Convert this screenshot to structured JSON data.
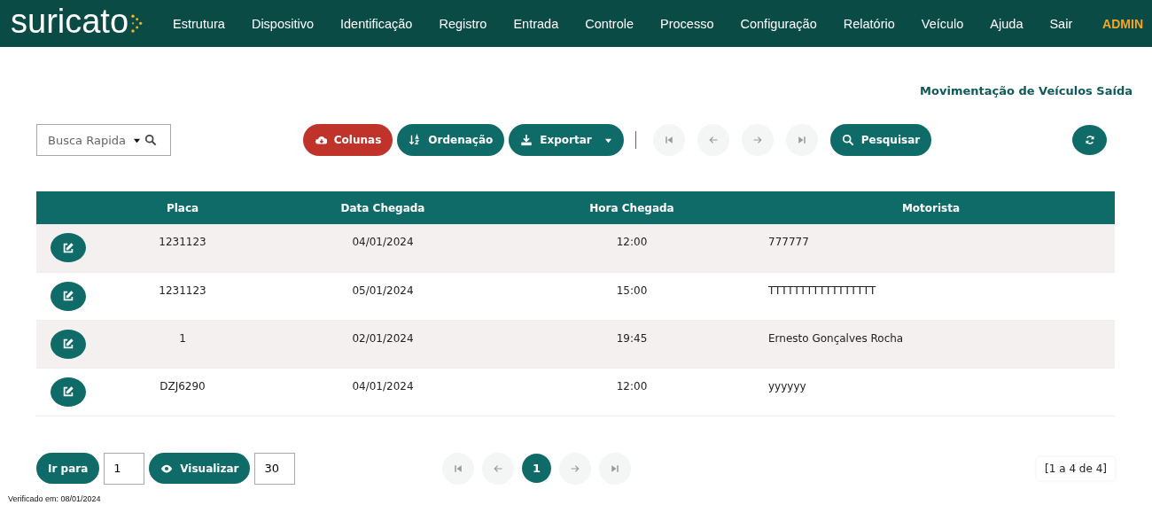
{
  "navbar": {
    "logo": "suricato",
    "items": [
      "Estrutura",
      "Dispositivo",
      "Identificação",
      "Registro",
      "Entrada",
      "Controle",
      "Processo",
      "Configuração",
      "Relatório",
      "Veículo",
      "Ajuda",
      "Sair"
    ],
    "user": "ADMIN"
  },
  "page_title": "Movimentação de Veículos Saída",
  "search": {
    "placeholder": "Busca Rapida"
  },
  "toolbar": [
    {
      "kind": "columns",
      "label": "Colunas",
      "dropdown": false
    },
    {
      "kind": "sort",
      "label": "Ordenação",
      "dropdown": false
    },
    {
      "kind": "export",
      "label": "Exportar",
      "dropdown": true
    },
    {
      "kind": "separator"
    },
    {
      "kind": "first",
      "disabled": true
    },
    {
      "kind": "prev",
      "disabled": true
    },
    {
      "kind": "next",
      "disabled": true
    },
    {
      "kind": "last",
      "disabled": true
    },
    {
      "kind": "search",
      "label": "Pesquisar",
      "dropdown": false
    }
  ],
  "table": {
    "columns": [
      "Placa",
      "Data Chegada",
      "Hora Chegada",
      "Motorista"
    ],
    "rows": [
      [
        "1231123",
        "04/01/2024",
        "12:00",
        "777777"
      ],
      [
        "1231123",
        "05/01/2024",
        "15:00",
        "TTTTTTTTTTTTTTTTT"
      ],
      [
        "1",
        "02/01/2024",
        "19:45",
        "Ernesto Gonçalves Rocha"
      ],
      [
        "DZJ6290",
        "04/01/2024",
        "12:00",
        "yyyyyy"
      ]
    ]
  },
  "footer_controls": {
    "goto_label": "Ir para",
    "goto_value": "1",
    "view_label": "Visualizar",
    "view_value": "30"
  },
  "pagination": [
    {
      "kind": "first",
      "disabled": true
    },
    {
      "kind": "prev",
      "disabled": true
    },
    {
      "kind": "page",
      "label": "1",
      "selected": true
    },
    {
      "kind": "next",
      "disabled": true
    },
    {
      "kind": "last",
      "disabled": true
    }
  ],
  "range": "[1 a 4 de 4]",
  "verified": "Verificado em: 08/01/2024"
}
